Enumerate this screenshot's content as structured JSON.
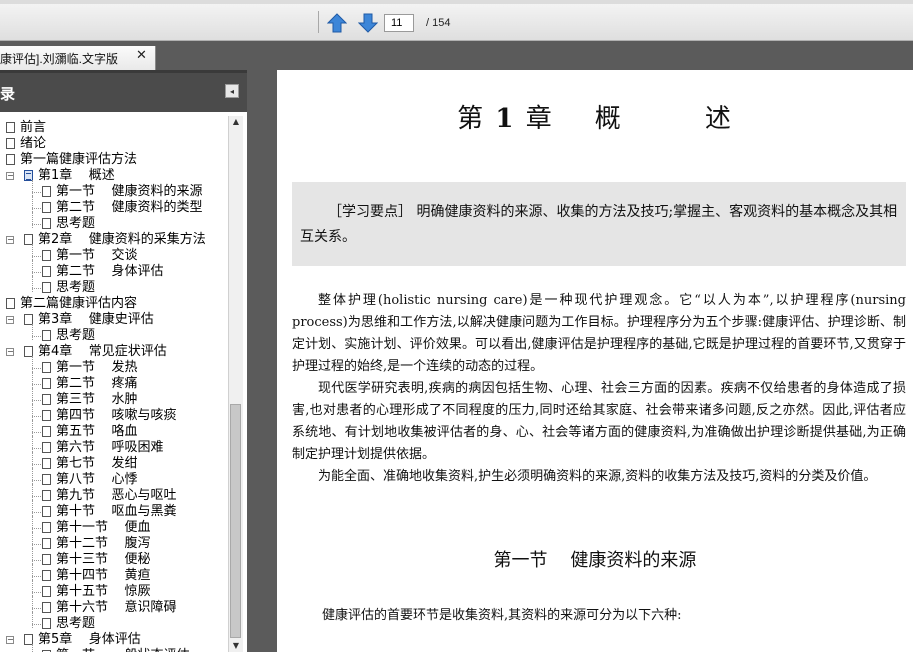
{
  "toolbar": {
    "current_page": "11",
    "total_pages": "/ 154"
  },
  "tab": {
    "title": "康评估].刘瀰临.文字版",
    "close": "✕"
  },
  "sidebar": {
    "title": "录",
    "collapse_icon": "◂",
    "items": [
      {
        "label": "前言",
        "level": 0,
        "expander": "none",
        "selected": false
      },
      {
        "label": "绪论",
        "level": 0,
        "expander": "none",
        "selected": false
      },
      {
        "label": "第一篇健康评估方法",
        "level": 0,
        "expander": "none",
        "selected": false
      },
      {
        "label": "第1章    概述",
        "level": 1,
        "expander": "minus",
        "selected": true
      },
      {
        "label": "第一节    健康资料的来源",
        "level": 2,
        "expander": "none",
        "selected": false
      },
      {
        "label": "第二节    健康资料的类型",
        "level": 2,
        "expander": "none",
        "selected": false
      },
      {
        "label": "思考题",
        "level": 2,
        "expander": "none",
        "selected": false
      },
      {
        "label": "第2章    健康资料的采集方法",
        "level": 1,
        "expander": "minus",
        "selected": false
      },
      {
        "label": "第一节    交谈",
        "level": 2,
        "expander": "none",
        "selected": false
      },
      {
        "label": "第二节    身体评估",
        "level": 2,
        "expander": "none",
        "selected": false
      },
      {
        "label": "思考题",
        "level": 2,
        "expander": "none",
        "selected": false
      },
      {
        "label": "第二篇健康评估内容",
        "level": 0,
        "expander": "none",
        "selected": false
      },
      {
        "label": "第3章    健康史评估",
        "level": 1,
        "expander": "minus",
        "selected": false
      },
      {
        "label": "思考题",
        "level": 2,
        "expander": "none",
        "selected": false
      },
      {
        "label": "第4章    常见症状评估",
        "level": 1,
        "expander": "minus",
        "selected": false
      },
      {
        "label": "第一节    发热",
        "level": 2,
        "expander": "none",
        "selected": false
      },
      {
        "label": "第二节    疼痛",
        "level": 2,
        "expander": "none",
        "selected": false
      },
      {
        "label": "第三节    水肿",
        "level": 2,
        "expander": "none",
        "selected": false
      },
      {
        "label": "第四节    咳嗽与咳痰",
        "level": 2,
        "expander": "none",
        "selected": false
      },
      {
        "label": "第五节    咯血",
        "level": 2,
        "expander": "none",
        "selected": false
      },
      {
        "label": "第六节    呼吸困难",
        "level": 2,
        "expander": "none",
        "selected": false
      },
      {
        "label": "第七节    发绀",
        "level": 2,
        "expander": "none",
        "selected": false
      },
      {
        "label": "第八节    心悸",
        "level": 2,
        "expander": "none",
        "selected": false
      },
      {
        "label": "第九节    恶心与呕吐",
        "level": 2,
        "expander": "none",
        "selected": false
      },
      {
        "label": "第十节    呕血与黑粪",
        "level": 2,
        "expander": "none",
        "selected": false
      },
      {
        "label": "第十一节    便血",
        "level": 2,
        "expander": "none",
        "selected": false
      },
      {
        "label": "第十二节    腹泻",
        "level": 2,
        "expander": "none",
        "selected": false
      },
      {
        "label": "第十三节    便秘",
        "level": 2,
        "expander": "none",
        "selected": false
      },
      {
        "label": "第十四节    黄疸",
        "level": 2,
        "expander": "none",
        "selected": false
      },
      {
        "label": "第十五节    惊厥",
        "level": 2,
        "expander": "none",
        "selected": false
      },
      {
        "label": "第十六节    意识障碍",
        "level": 2,
        "expander": "none",
        "selected": false
      },
      {
        "label": "思考题",
        "level": 2,
        "expander": "none",
        "selected": false
      },
      {
        "label": "第5章    身体评估",
        "level": 1,
        "expander": "minus",
        "selected": false
      },
      {
        "label": "第一节    一般状态评估",
        "level": 2,
        "expander": "none",
        "selected": false
      }
    ]
  },
  "document": {
    "chapter_prefix": "第",
    "chapter_num": "1",
    "chapter_suffix": "章    概        述",
    "key_points": "［学习要点］  明确健康资料的来源、收集的方法及技巧;掌握主、客观资料的基本概念及其相互关系。",
    "paragraphs": [
      "整体护理(holistic nursing care)是一种现代护理观念。它“以人为本”,以护理程序(nursing process)为思维和工作方法,以解决健康问题为工作目标。护理程序分为五个步骤:健康评估、护理诊断、制定计划、实施计划、评价效果。可以看出,健康评估是护理程序的基础,它既是护理过程的首要环节,又贯穿于护理过程的始终,是一个连续的动态的过程。",
      "现代医学研究表明,疾病的病因包括生物、心理、社会三方面的因素。疾病不仅给患者的身体造成了损害,也对患者的心理形成了不同程度的压力,同时还给其家庭、社会带来诸多问题,反之亦然。因此,评估者应系统地、有计划地收集被评估者的身、心、社会等诸方面的健康资料,为准确做出护理诊断提供基础,为正确制定护理计划提供依据。",
      "为能全面、准确地收集资料,护生必须明确资料的来源,资料的收集方法及技巧,资料的分类及价值。"
    ],
    "section_title": "第一节    健康资料的来源",
    "section_intro": "健康评估的首要环节是收集资料,其资料的来源可分为以下六种:"
  }
}
